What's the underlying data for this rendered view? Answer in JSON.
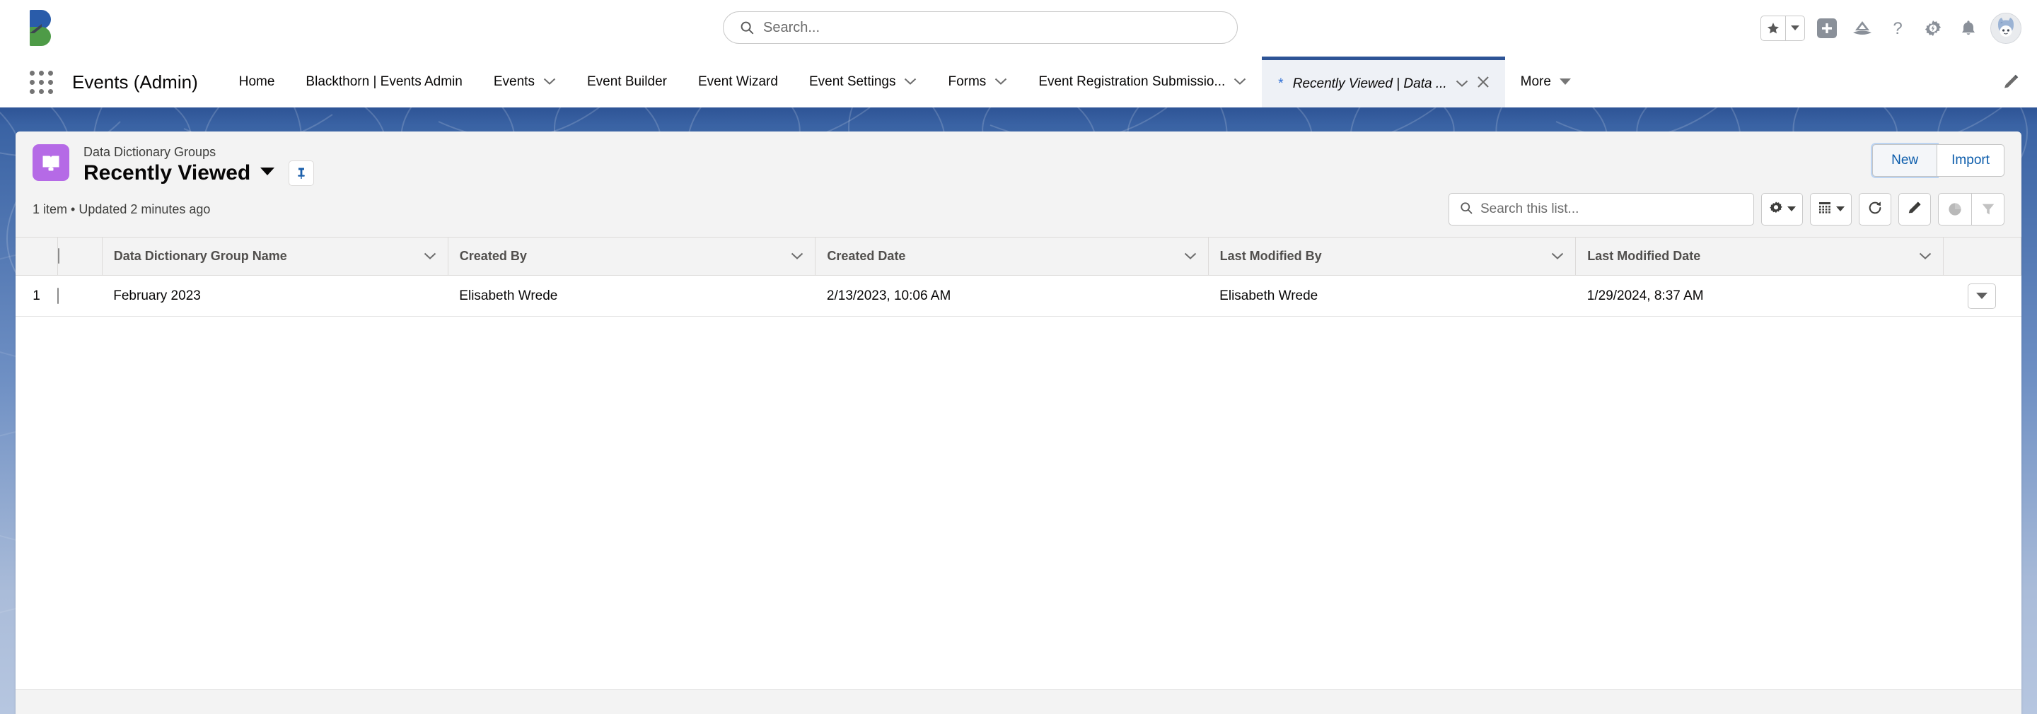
{
  "global_header": {
    "logo_name": "blackthorn-logo",
    "search": {
      "placeholder": "Search..."
    },
    "actions": [
      {
        "name": "favorites-star-button",
        "icon": "star-icon",
        "label": ""
      },
      {
        "name": "favorites-dropdown-button",
        "icon": "caret-down-icon",
        "label": ""
      },
      {
        "name": "global-add-button",
        "icon": "plus-icon",
        "label": ""
      },
      {
        "name": "salesforce-app-icon",
        "icon": "mountain-icon",
        "label": ""
      },
      {
        "name": "help-button",
        "icon": "question-icon",
        "label": ""
      },
      {
        "name": "setup-button",
        "icon": "gear-lightning-icon",
        "label": ""
      },
      {
        "name": "notifications-button",
        "icon": "bell-icon",
        "label": ""
      },
      {
        "name": "user-avatar",
        "icon": "avatar-icon",
        "label": ""
      }
    ]
  },
  "nav": {
    "app_name": "Events (Admin)",
    "items": [
      {
        "label": "Home",
        "has_dropdown": false
      },
      {
        "label": "Blackthorn | Events Admin",
        "has_dropdown": false
      },
      {
        "label": "Events",
        "has_dropdown": true
      },
      {
        "label": "Event Builder",
        "has_dropdown": false
      },
      {
        "label": "Event Wizard",
        "has_dropdown": false
      },
      {
        "label": "Event Settings",
        "has_dropdown": true
      },
      {
        "label": "Forms",
        "has_dropdown": true
      },
      {
        "label": "Event Registration Submissio...",
        "has_dropdown": true
      }
    ],
    "active_tab": {
      "star": "*",
      "label": "Recently Viewed | Data ...",
      "has_dropdown": true,
      "has_close": true
    },
    "more_label": "More",
    "edit_icon": "pencil-icon"
  },
  "list_view": {
    "breadcrumb": "Data Dictionary Groups",
    "title": "Recently Viewed",
    "object_icon": "book-icon",
    "object_icon_color": "#b56ae6",
    "pin_icon": "pin-icon",
    "meta": "1 item • Updated 2 minutes ago",
    "buttons": [
      {
        "label": "New",
        "name": "new-button"
      },
      {
        "label": "Import",
        "name": "import-button"
      }
    ],
    "search": {
      "placeholder": "Search this list..."
    },
    "tools": [
      {
        "name": "list-view-controls-button",
        "icon": "gear-icon"
      },
      {
        "name": "display-as-button",
        "icon": "table-icon"
      },
      {
        "name": "refresh-button",
        "icon": "refresh-icon"
      },
      {
        "name": "edit-list-button",
        "icon": "pencil-icon"
      },
      {
        "name": "charts-button",
        "icon": "chart-icon"
      },
      {
        "name": "filters-button",
        "icon": "filter-icon"
      }
    ]
  },
  "table": {
    "columns": [
      "Data Dictionary Group Name",
      "Created By",
      "Created Date",
      "Last Modified By",
      "Last Modified Date"
    ],
    "rows": [
      {
        "index": "1",
        "name": "February 2023",
        "created_by": "Elisabeth Wrede",
        "created_date": "2/13/2023, 10:06 AM",
        "last_modified_by": "Elisabeth Wrede",
        "last_modified_date": "1/29/2024, 8:37 AM"
      }
    ]
  },
  "colors": {
    "accent_blue": "#0b5cab",
    "header_blue": "#2e5496",
    "object_purple": "#b56ae6"
  }
}
